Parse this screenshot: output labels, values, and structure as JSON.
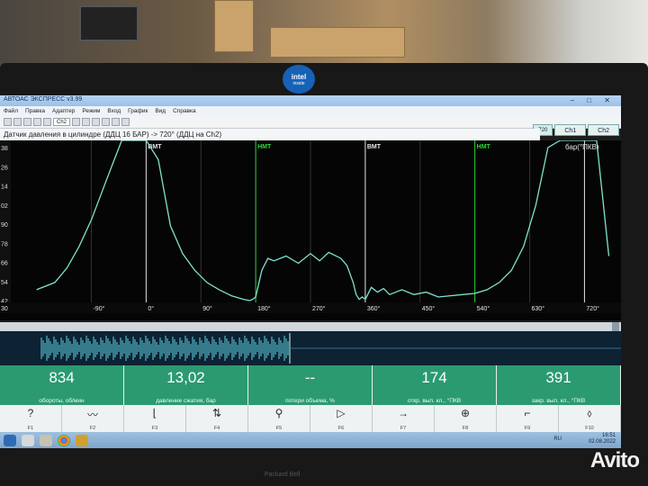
{
  "window": {
    "title": "АВТОАС ЭКСПРЕСС v3.99",
    "controls": "– □ ✕"
  },
  "menu": [
    "Файл",
    "Правка",
    "Адаптер",
    "Режим",
    "Вход",
    "График",
    "Вид",
    "Справка"
  ],
  "toolbar": {
    "channel": "Ch2"
  },
  "channel_buttons": {
    "mode": "720",
    "ch1": "Ch1",
    "ch2": "Ch2"
  },
  "channel_title": "Датчик давления в цилиндре (ДДЦ 16 БАР) -> 720° (ДДЦ на Ch2)",
  "chart_data": {
    "type": "line",
    "unit_label": "бар(°ПКВ)",
    "y_ticks": [
      "38",
      "26",
      "14",
      "02",
      "90",
      "78",
      "66",
      "54",
      "42"
    ],
    "x_ticks": [
      "30",
      "-90°",
      "0°",
      "90°",
      "180°",
      "270°",
      "360°",
      "450°",
      "540°",
      "630°",
      "720°"
    ],
    "markers": [
      {
        "label": "ВМТ",
        "x": 0,
        "color": "#e6e6e6"
      },
      {
        "label": "НМТ",
        "x": 180,
        "color": "#2ed63a"
      },
      {
        "label": "ВМТ",
        "x": 360,
        "color": "#e6e6e6"
      },
      {
        "label": "НМТ",
        "x": 540,
        "color": "#2ed63a"
      }
    ],
    "series": [
      {
        "color": "#7fe3cf",
        "x": [
          -180,
          -150,
          -130,
          -110,
          -90,
          -60,
          -40,
          -20,
          -5,
          0,
          20,
          40,
          60,
          80,
          100,
          120,
          140,
          160,
          170,
          175,
          180,
          190,
          200,
          210,
          230,
          250,
          270,
          285,
          300,
          320,
          330,
          340,
          345,
          350,
          355,
          360,
          370,
          380,
          390,
          400,
          420,
          440,
          460,
          480,
          500,
          520,
          540,
          560,
          580,
          600,
          620,
          640,
          660,
          680,
          700,
          720,
          740,
          760
        ],
        "y": [
          42,
          48,
          60,
          78,
          100,
          140,
          170,
          200,
          240,
          260,
          150,
          95,
          72,
          58,
          48,
          42,
          37,
          34,
          33,
          34,
          36,
          58,
          68,
          66,
          70,
          64,
          72,
          66,
          73,
          68,
          62,
          48,
          38,
          34,
          36,
          34,
          44,
          40,
          43,
          38,
          42,
          38,
          40,
          36,
          37,
          38,
          39,
          42,
          48,
          58,
          78,
          112,
          160,
          210,
          250,
          280,
          210,
          70
        ]
      }
    ]
  },
  "readouts": [
    {
      "value": "834",
      "label": "обороты, об/мин"
    },
    {
      "value": "13,02",
      "label": "давление сжатия, бар"
    },
    {
      "value": "--",
      "label": "потери объема, %"
    },
    {
      "value": "174",
      "label": "откр. вып. кл., °ПКВ"
    },
    {
      "value": "391",
      "label": "закр. вып. кл., °ПКВ"
    }
  ],
  "fkeys": [
    {
      "icon": "?",
      "key": "F1"
    },
    {
      "icon": "〰",
      "key": "F2"
    },
    {
      "icon": "⌊",
      "key": "F3"
    },
    {
      "icon": "⇅",
      "key": "F4"
    },
    {
      "icon": "⚲",
      "key": "F5"
    },
    {
      "icon": "▷",
      "key": "F6"
    },
    {
      "icon": "→",
      "key": "F7"
    },
    {
      "icon": "⊕",
      "key": "F8"
    },
    {
      "icon": "⌐",
      "key": "F9"
    },
    {
      "icon": "⬨",
      "key": "F10"
    }
  ],
  "taskbar": {
    "lang": "RU",
    "time": "16:51",
    "date": "02.08.2022"
  },
  "watermark": "Avito",
  "laptop_brand": "Packard Bell",
  "intel": {
    "name": "intel",
    "sub": "inside"
  }
}
